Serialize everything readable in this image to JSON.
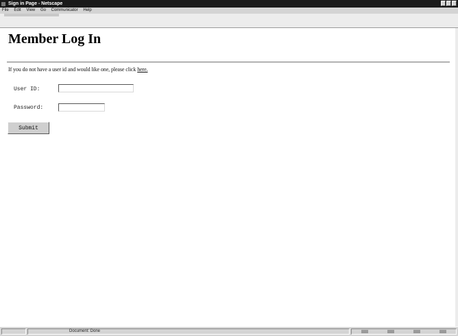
{
  "window": {
    "title": "Sign in Page - Netscape"
  },
  "menu": {
    "items": [
      "File",
      "Edit",
      "View",
      "Go",
      "Communicator",
      "Help"
    ]
  },
  "page": {
    "heading": "Member Log In",
    "intro_text": "If you do not have a user id and would like one, please click ",
    "intro_link": "here."
  },
  "form": {
    "userid_label": "User ID:",
    "userid_value": "",
    "password_label": "Password:",
    "password_value": "",
    "submit_label": "Submit"
  },
  "statusbar": {
    "status_text": "Document: Done"
  },
  "icons": {
    "app": "netscape-icon",
    "minimize": "minimize-icon",
    "maximize": "maximize-icon",
    "close": "close-icon",
    "security": "security-lock-icon"
  },
  "colors": {
    "titlebar": "#1a1a1a",
    "chrome": "#d4d4d4"
  }
}
